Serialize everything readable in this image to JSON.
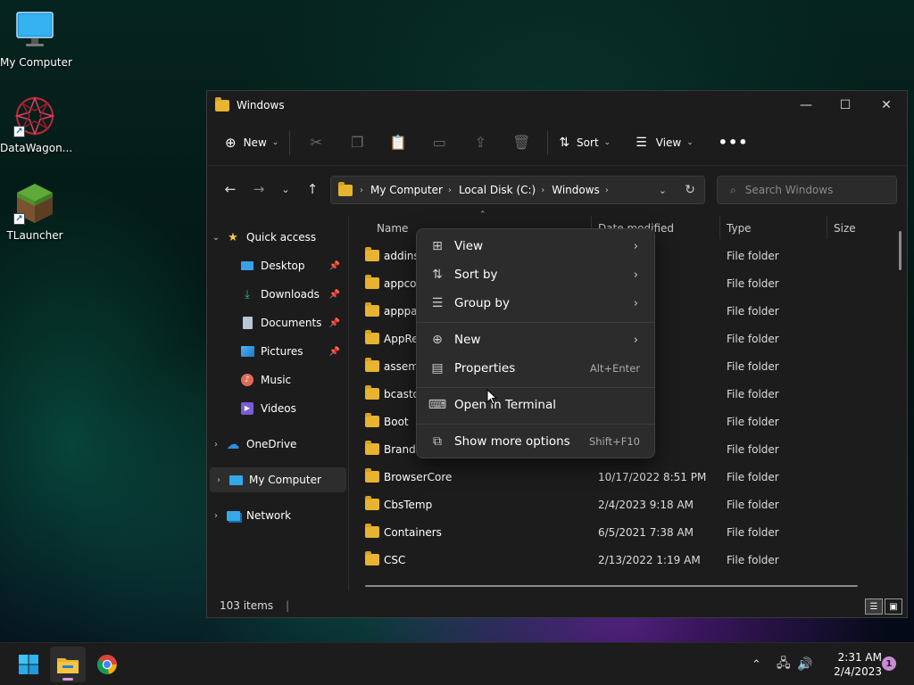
{
  "desktop": {
    "icons": [
      {
        "label": "My Computer"
      },
      {
        "label": "DataWagon..."
      },
      {
        "label": "TLauncher"
      }
    ]
  },
  "window": {
    "title": "Windows",
    "toolbar": {
      "new_label": "New",
      "sort_label": "Sort",
      "view_label": "View"
    },
    "address": {
      "crumbs": [
        "My Computer",
        "Local Disk (C:)",
        "Windows"
      ]
    },
    "search": {
      "placeholder": "Search Windows"
    },
    "sidebar": {
      "quick_access": "Quick access",
      "items": [
        {
          "label": "Desktop"
        },
        {
          "label": "Downloads"
        },
        {
          "label": "Documents"
        },
        {
          "label": "Pictures"
        },
        {
          "label": "Music"
        },
        {
          "label": "Videos"
        }
      ],
      "onedrive": "OneDrive",
      "my_computer": "My Computer",
      "network": "Network"
    },
    "columns": {
      "name": "Name",
      "date": "Date modified",
      "type": "Type",
      "size": "Size"
    },
    "files": [
      {
        "name": "addins",
        "date": "0 AM",
        "type": "File folder"
      },
      {
        "name": "appcor",
        "date": ":13 PM",
        "type": "File folder"
      },
      {
        "name": "apppat",
        "date": "8:51 PM",
        "type": "File folder"
      },
      {
        "name": "AppRe",
        "date": "3 AM",
        "type": "File folder"
      },
      {
        "name": "assemb",
        "date": "4 AM",
        "type": "File folder"
      },
      {
        "name": "bcastd",
        "date": "8:51 PM",
        "type": "File folder"
      },
      {
        "name": "Boot",
        "date": "0 AM",
        "type": "File folder"
      },
      {
        "name": "Brandi",
        "date": "0 AM",
        "type": "File folder"
      },
      {
        "name": "BrowserCore",
        "date": "10/17/2022 8:51 PM",
        "type": "File folder"
      },
      {
        "name": "CbsTemp",
        "date": "2/4/2023 9:18 AM",
        "type": "File folder"
      },
      {
        "name": "Containers",
        "date": "6/5/2021 7:38 AM",
        "type": "File folder"
      },
      {
        "name": "CSC",
        "date": "2/13/2022 1:19 AM",
        "type": "File folder"
      }
    ],
    "status": {
      "items": "103 items"
    }
  },
  "context_menu": {
    "items": [
      {
        "label": "View"
      },
      {
        "label": "Sort by"
      },
      {
        "label": "Group by"
      },
      {
        "label": "New"
      },
      {
        "label": "Properties",
        "accel": "Alt+Enter"
      },
      {
        "label": "Open in Terminal"
      },
      {
        "label": "Show more options",
        "accel": "Shift+F10"
      }
    ]
  },
  "taskbar": {
    "time": "2:31 AM",
    "date": "2/4/2023",
    "notifications": "1"
  },
  "colors": {
    "accent": "#4cc2ff",
    "folder": "#e8b32f"
  }
}
